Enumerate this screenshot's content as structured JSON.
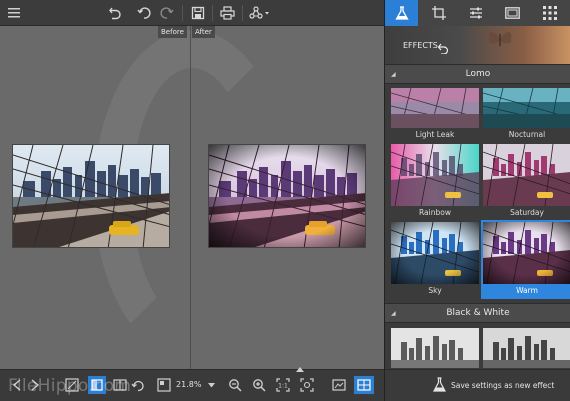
{
  "canvas": {
    "before_label": "Before",
    "after_label": "After"
  },
  "bottom_toolbar": {
    "zoom_value": "21.8%",
    "watermark": "FileHippo.com"
  },
  "effects_panel": {
    "header_label": "EFFECTS",
    "groups": [
      {
        "name": "Lomo",
        "items": [
          {
            "label": "Light Leak"
          },
          {
            "label": "Nocturnal"
          },
          {
            "label": "Rainbow"
          },
          {
            "label": "Saturday"
          },
          {
            "label": "Sky"
          },
          {
            "label": "Warm",
            "selected": true
          }
        ]
      },
      {
        "name": "Black & White",
        "items": []
      }
    ],
    "save_label": "Save settings as new effect"
  },
  "colors": {
    "accent": "#2b7fd6",
    "panel_bg": "#3b3b3b",
    "canvas_bg": "#6a6a6a"
  },
  "icons": [
    "menu-icon",
    "undo-icon",
    "undo-step-icon",
    "redo-icon",
    "save-icon",
    "print-icon",
    "share-icon",
    "effects-flask-icon",
    "crop-icon",
    "adjust-sliders-icon",
    "frame-icon",
    "texture-icon",
    "back-arrow-icon",
    "fit-icon",
    "actual-size-icon",
    "compare-icon",
    "rotate-icon",
    "zoom-out-icon",
    "zoom-in-icon",
    "fit-screen-icon",
    "fullscreen-icon",
    "flask-icon"
  ]
}
